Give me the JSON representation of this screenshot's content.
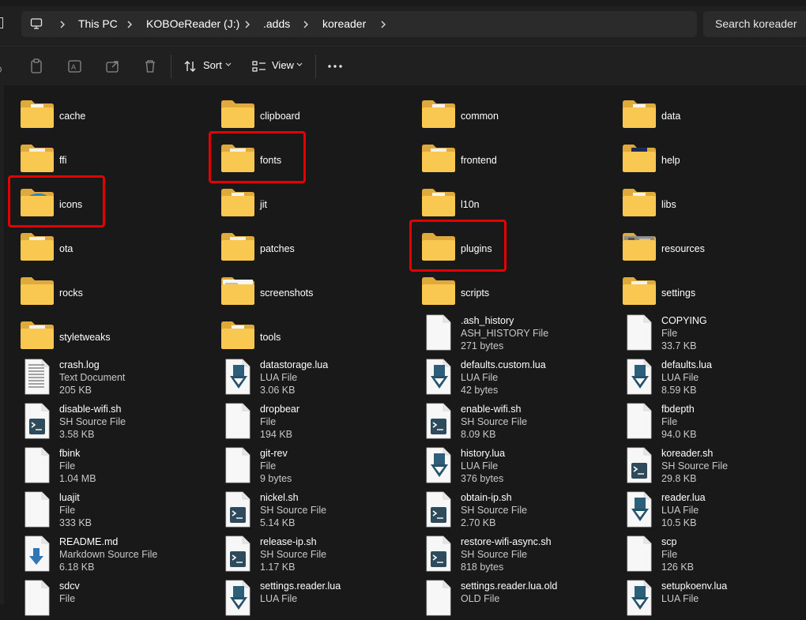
{
  "address": {
    "crumbs": [
      "This PC",
      "KOBOeReader (J:)",
      ".adds",
      "koreader"
    ]
  },
  "search": {
    "placeholder": "Search koreader"
  },
  "toolbar": {
    "sort_label": "Sort",
    "view_label": "View"
  },
  "colors": {
    "highlight": "#e50000",
    "folder": "#f8c850",
    "background": "#191919"
  },
  "folders": [
    {
      "name": "cache",
      "overlay": "paper"
    },
    {
      "name": "clipboard",
      "overlay": "none"
    },
    {
      "name": "common",
      "overlay": "paper"
    },
    {
      "name": "data",
      "overlay": "paper"
    },
    {
      "name": "ffi",
      "overlay": "teal"
    },
    {
      "name": "fonts",
      "overlay": "teal"
    },
    {
      "name": "frontend",
      "overlay": "teal"
    },
    {
      "name": "help",
      "overlay": "dark"
    },
    {
      "name": "icons",
      "overlay": "koreader-logo"
    },
    {
      "name": "jit",
      "overlay": "paper"
    },
    {
      "name": "l10n",
      "overlay": "paper"
    },
    {
      "name": "libs",
      "overlay": "paper"
    },
    {
      "name": "ota",
      "overlay": "teal"
    },
    {
      "name": "patches",
      "overlay": "teal"
    },
    {
      "name": "plugins",
      "overlay": "none"
    },
    {
      "name": "resources",
      "overlay": "photo"
    },
    {
      "name": "rocks",
      "overlay": "none"
    },
    {
      "name": "screenshots",
      "overlay": "screenshot"
    },
    {
      "name": "scripts",
      "overlay": "none"
    },
    {
      "name": "settings",
      "overlay": "teal"
    },
    {
      "name": "styletweaks",
      "overlay": "teal"
    },
    {
      "name": "tools",
      "overlay": "paper"
    }
  ],
  "files": [
    {
      "name": ".ash_history",
      "type": "ASH_HISTORY File",
      "size": "271 bytes",
      "icon": "blank-file-icon"
    },
    {
      "name": "COPYING",
      "type": "File",
      "size": "33.7 KB",
      "icon": "blank-file-icon"
    },
    {
      "name": "crash.log",
      "type": "Text Document",
      "size": "205 KB",
      "icon": "text-file-icon"
    },
    {
      "name": "datastorage.lua",
      "type": "LUA File",
      "size": "3.06 KB",
      "icon": "lua-file-icon"
    },
    {
      "name": "defaults.custom.lua",
      "type": "LUA File",
      "size": "42 bytes",
      "icon": "lua-file-icon"
    },
    {
      "name": "defaults.lua",
      "type": "LUA File",
      "size": "8.59 KB",
      "icon": "lua-file-icon"
    },
    {
      "name": "disable-wifi.sh",
      "type": "SH Source File",
      "size": "3.58 KB",
      "icon": "shell-file-icon"
    },
    {
      "name": "dropbear",
      "type": "File",
      "size": "194 KB",
      "icon": "blank-file-icon"
    },
    {
      "name": "enable-wifi.sh",
      "type": "SH Source File",
      "size": "8.09 KB",
      "icon": "shell-file-icon"
    },
    {
      "name": "fbdepth",
      "type": "File",
      "size": "94.0 KB",
      "icon": "blank-file-icon"
    },
    {
      "name": "fbink",
      "type": "File",
      "size": "1.04 MB",
      "icon": "blank-file-icon"
    },
    {
      "name": "git-rev",
      "type": "File",
      "size": "9 bytes",
      "icon": "blank-file-icon"
    },
    {
      "name": "history.lua",
      "type": "LUA File",
      "size": "376 bytes",
      "icon": "lua-file-icon"
    },
    {
      "name": "koreader.sh",
      "type": "SH Source File",
      "size": "29.8 KB",
      "icon": "shell-file-icon"
    },
    {
      "name": "luajit",
      "type": "File",
      "size": "333 KB",
      "icon": "blank-file-icon"
    },
    {
      "name": "nickel.sh",
      "type": "SH Source File",
      "size": "5.14 KB",
      "icon": "shell-file-icon"
    },
    {
      "name": "obtain-ip.sh",
      "type": "SH Source File",
      "size": "2.70 KB",
      "icon": "shell-file-icon"
    },
    {
      "name": "reader.lua",
      "type": "LUA File",
      "size": "10.5 KB",
      "icon": "lua-file-icon"
    },
    {
      "name": "README.md",
      "type": "Markdown Source File",
      "size": "6.18 KB",
      "icon": "markdown-file-icon"
    },
    {
      "name": "release-ip.sh",
      "type": "SH Source File",
      "size": "1.17 KB",
      "icon": "shell-file-icon"
    },
    {
      "name": "restore-wifi-async.sh",
      "type": "SH Source File",
      "size": "818 bytes",
      "icon": "shell-file-icon"
    },
    {
      "name": "scp",
      "type": "File",
      "size": "126 KB",
      "icon": "blank-file-icon"
    },
    {
      "name": "sdcv",
      "type": "File",
      "size": "",
      "icon": "blank-file-icon"
    },
    {
      "name": "settings.reader.lua",
      "type": "LUA File",
      "size": "",
      "icon": "lua-file-icon"
    },
    {
      "name": "settings.reader.lua.old",
      "type": "OLD File",
      "size": "",
      "icon": "blank-file-icon"
    },
    {
      "name": "setupkoenv.lua",
      "type": "LUA File",
      "size": "",
      "icon": "lua-file-icon"
    }
  ],
  "highlighted": [
    "fonts",
    "icons",
    "plugins"
  ]
}
